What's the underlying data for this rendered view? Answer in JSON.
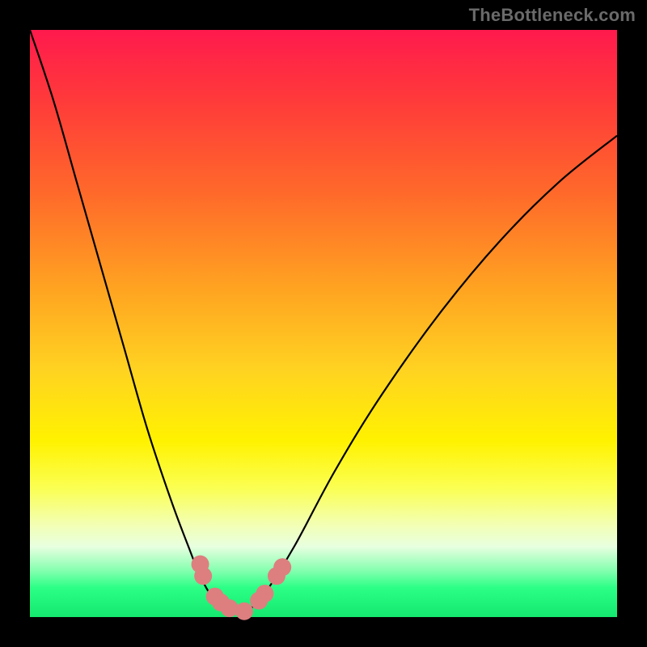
{
  "watermark": "TheBottleneck.com",
  "colors": {
    "frame": "#000000",
    "top": "#ff1a4d",
    "bottom": "#15e86e",
    "curve": "#000000",
    "marker": "#dd7f7f"
  },
  "chart_data": {
    "type": "line",
    "title": "",
    "xlabel": "",
    "ylabel": "",
    "xlim": [
      0,
      100
    ],
    "ylim": [
      0,
      100
    ],
    "x": [
      0,
      4,
      8,
      12,
      16,
      20,
      24,
      27,
      29,
      31,
      33,
      35,
      36.5,
      38,
      40,
      45,
      52,
      60,
      70,
      80,
      90,
      100
    ],
    "y": [
      100,
      88,
      74,
      60,
      46,
      32,
      20,
      12,
      7,
      3.5,
      2,
      1.2,
      1,
      1.8,
      4,
      12,
      25,
      38,
      52,
      64,
      74,
      82
    ],
    "series": [
      {
        "name": "bottleneck-curve",
        "x": [
          0,
          4,
          8,
          12,
          16,
          20,
          24,
          27,
          29,
          31,
          33,
          35,
          36.5,
          38,
          40,
          45,
          52,
          60,
          70,
          80,
          90,
          100
        ],
        "y": [
          100,
          88,
          74,
          60,
          46,
          32,
          20,
          12,
          7,
          3.5,
          2,
          1.2,
          1,
          1.8,
          4,
          12,
          25,
          38,
          52,
          64,
          74,
          82
        ]
      }
    ],
    "markers": [
      {
        "x": 29,
        "y": 9
      },
      {
        "x": 29.5,
        "y": 7
      },
      {
        "x": 31.5,
        "y": 3.5
      },
      {
        "x": 32.5,
        "y": 2.5
      },
      {
        "x": 34,
        "y": 1.5
      },
      {
        "x": 36.5,
        "y": 1
      },
      {
        "x": 39,
        "y": 2.8
      },
      {
        "x": 40,
        "y": 4
      },
      {
        "x": 42,
        "y": 7
      },
      {
        "x": 43,
        "y": 8.5
      }
    ]
  }
}
